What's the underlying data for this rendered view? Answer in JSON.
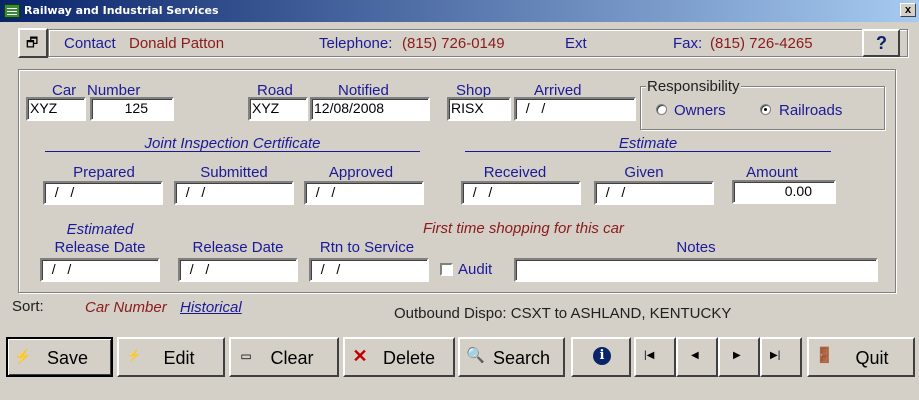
{
  "window": {
    "title": "Railway and Industrial Services",
    "close": "x"
  },
  "header": {
    "contact_label": "Contact",
    "contact_name": "Donald Patton",
    "telephone_label": "Telephone:",
    "telephone": "(815) 726-0149",
    "ext_label": "Ext",
    "fax_label": "Fax:",
    "fax": "(815) 726-4265",
    "help": "?"
  },
  "car": {
    "car_label": "Car",
    "number_label": "Number",
    "car": "XYZ",
    "number": "125",
    "road_label": "Road",
    "road": "XYZ",
    "notified_label": "Notified",
    "notified": "12/08/2008",
    "shop_label": "Shop",
    "shop": "RISX",
    "arrived_label": "Arrived",
    "arrived": "  /   /"
  },
  "responsibility": {
    "label": "Responsibility",
    "owners": "Owners",
    "railroads": "Railroads",
    "selected": "Railroads"
  },
  "jic": {
    "heading": "Joint Inspection Certificate",
    "prepared_label": "Prepared",
    "prepared": "  /   /",
    "submitted_label": "Submitted",
    "submitted": "  /   /",
    "approved_label": "Approved",
    "approved": "  /   /"
  },
  "estimate": {
    "heading": "Estimate",
    "received_label": "Received",
    "received": "  /   /",
    "given_label": "Given",
    "given": "  /   /",
    "amount_label": "Amount",
    "amount": "0.00"
  },
  "release": {
    "estimated_label": "Estimated",
    "release_date_label": "Release Date",
    "estimated_release": "  /   /",
    "release_date_label2": "Release Date",
    "release_date": "  /   /",
    "rtn_label": "Rtn to Service",
    "rtn": "  /   /",
    "first_time_msg": "First time shopping for this car",
    "audit_label": "Audit",
    "notes_label": "Notes",
    "notes": ""
  },
  "sort": {
    "label": "Sort:",
    "car_number": "Car Number",
    "historical": "Historical"
  },
  "outbound": "Outbound Dispo: CSXT to ASHLAND, KENTUCKY",
  "toolbar": {
    "save": "Save",
    "edit": "Edit",
    "clear": "Clear",
    "delete": "Delete",
    "search": "Search",
    "info": "i",
    "first": "|◀",
    "prev": "◀",
    "next": "▶",
    "last": "▶|",
    "quit": "Quit"
  }
}
